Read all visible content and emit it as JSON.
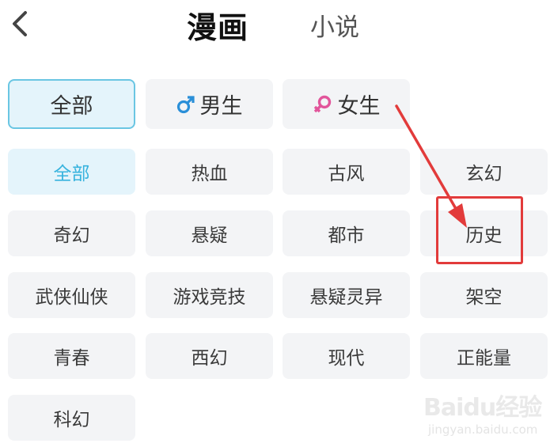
{
  "header": {
    "back_icon": "chevron-left-icon",
    "tab_active": "漫画",
    "tab_inactive": "小说"
  },
  "gender_filter": {
    "all": "全部",
    "male": "男生",
    "male_icon": "male-symbol-icon",
    "female": "女生",
    "female_icon": "female-symbol-icon"
  },
  "genres": [
    "全部",
    "热血",
    "古风",
    "玄幻",
    "奇幻",
    "悬疑",
    "都市",
    "历史",
    "武侠仙侠",
    "游戏竞技",
    "悬疑灵异",
    "架空",
    "青春",
    "西幻",
    "现代",
    "正能量",
    "科幻"
  ],
  "selected_genre": "全部",
  "annotation": {
    "highlighted": "历史",
    "color": "#e23b3b"
  },
  "colors": {
    "accent": "#37b3de",
    "selected_bg": "#e4f4fb",
    "chip_bg": "#f3f4f6",
    "male": "#2a8fd8",
    "female": "#e2559b"
  },
  "watermark": {
    "logo": "Baidu经验",
    "site": "jingyan.baidu.com"
  }
}
